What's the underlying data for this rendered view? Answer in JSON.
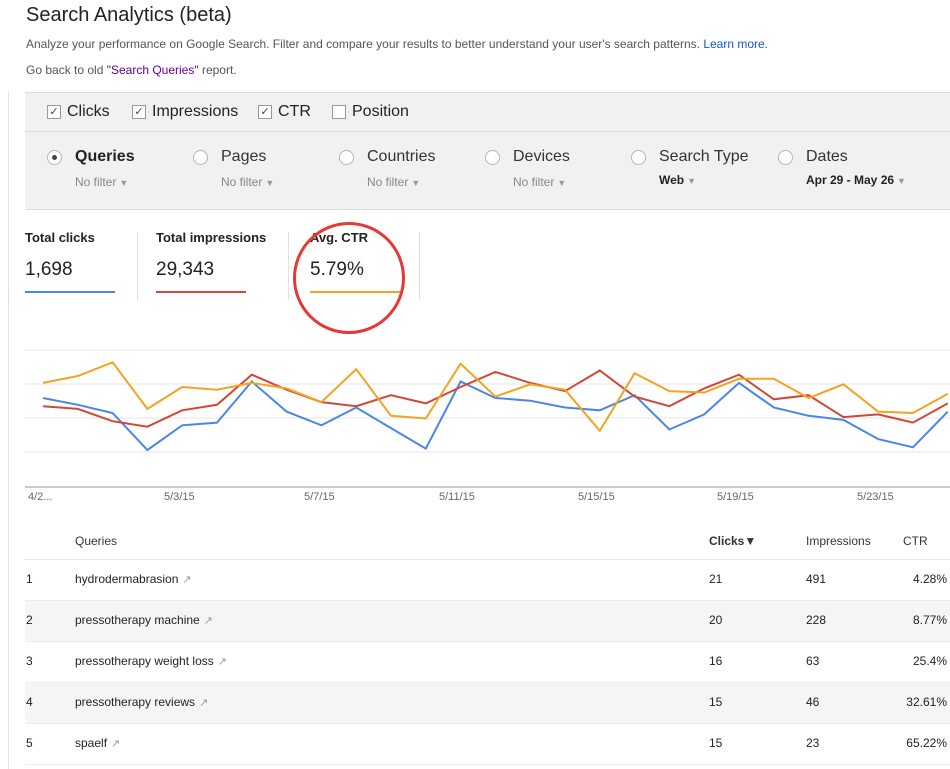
{
  "header": {
    "title": "Search Analytics (beta)",
    "description": "Analyze your performance on Google Search. Filter and compare your results to better understand your user's search patterns.",
    "learn_more": "Learn more.",
    "old_prefix": "Go back to old ",
    "old_link": "\"Search Queries\"",
    "old_suffix": " report."
  },
  "metrics": [
    {
      "label": "Clicks",
      "checked": true
    },
    {
      "label": "Impressions",
      "checked": true
    },
    {
      "label": "CTR",
      "checked": true
    },
    {
      "label": "Position",
      "checked": false
    }
  ],
  "groupings": [
    {
      "label": "Queries",
      "sub": "No filter",
      "selected": true
    },
    {
      "label": "Pages",
      "sub": "No filter",
      "selected": false
    },
    {
      "label": "Countries",
      "sub": "No filter",
      "selected": false
    },
    {
      "label": "Devices",
      "sub": "No filter",
      "selected": false
    },
    {
      "label": "Search Type",
      "sub": "Web",
      "selected": false
    },
    {
      "label": "Dates",
      "sub": "Apr 29 - May 26",
      "selected": false
    }
  ],
  "totals": [
    {
      "label": "Total clicks",
      "value": "1,698",
      "color": "#4a86e8"
    },
    {
      "label": "Total impressions",
      "value": "29,343",
      "color": "#d14836"
    },
    {
      "label": "Avg. CTR",
      "value": "5.79%",
      "color": "#f4a221"
    }
  ],
  "chart_data": {
    "type": "line",
    "x": [
      "4/2...",
      "5/3/15",
      "5/7/15",
      "5/11/15",
      "5/15/15",
      "5/19/15",
      "5/23/15"
    ],
    "series": [
      {
        "color": "#4a86e8",
        "values": [
          0.65,
          0.6,
          0.54,
          0.27,
          0.45,
          0.47,
          0.77,
          0.55,
          0.45,
          0.58,
          0.43,
          0.28,
          0.77,
          0.65,
          0.63,
          0.58,
          0.56,
          0.67,
          0.42,
          0.53,
          0.76,
          0.58,
          0.52,
          0.49,
          0.35,
          0.29,
          0.55
        ]
      },
      {
        "color": "#d14836",
        "values": [
          0.59,
          0.57,
          0.48,
          0.44,
          0.56,
          0.6,
          0.82,
          0.71,
          0.62,
          0.59,
          0.67,
          0.61,
          0.73,
          0.84,
          0.76,
          0.7,
          0.85,
          0.66,
          0.59,
          0.72,
          0.82,
          0.64,
          0.67,
          0.51,
          0.53,
          0.47,
          0.61
        ]
      },
      {
        "color": "#f4a221",
        "values": [
          0.76,
          0.81,
          0.91,
          0.57,
          0.73,
          0.71,
          0.76,
          0.72,
          0.62,
          0.86,
          0.52,
          0.5,
          0.9,
          0.66,
          0.75,
          0.71,
          0.41,
          0.83,
          0.7,
          0.69,
          0.79,
          0.79,
          0.65,
          0.75,
          0.55,
          0.54,
          0.68
        ]
      }
    ]
  },
  "table": {
    "headers": {
      "queries": "Queries",
      "clicks": "Clicks▼",
      "impressions": "Impressions",
      "ctr": "CTR"
    },
    "rows": [
      {
        "rank": "1",
        "query": "hydrodermabrasion",
        "clicks": "21",
        "impressions": "491",
        "ctr": "4.28%"
      },
      {
        "rank": "2",
        "query": "pressotherapy machine",
        "clicks": "20",
        "impressions": "228",
        "ctr": "8.77%"
      },
      {
        "rank": "3",
        "query": "pressotherapy weight loss",
        "clicks": "16",
        "impressions": "63",
        "ctr": "25.4%"
      },
      {
        "rank": "4",
        "query": "pressotherapy reviews",
        "clicks": "15",
        "impressions": "46",
        "ctr": "32.61%"
      },
      {
        "rank": "5",
        "query": "spaelf",
        "clicks": "15",
        "impressions": "23",
        "ctr": "65.22%"
      }
    ]
  }
}
